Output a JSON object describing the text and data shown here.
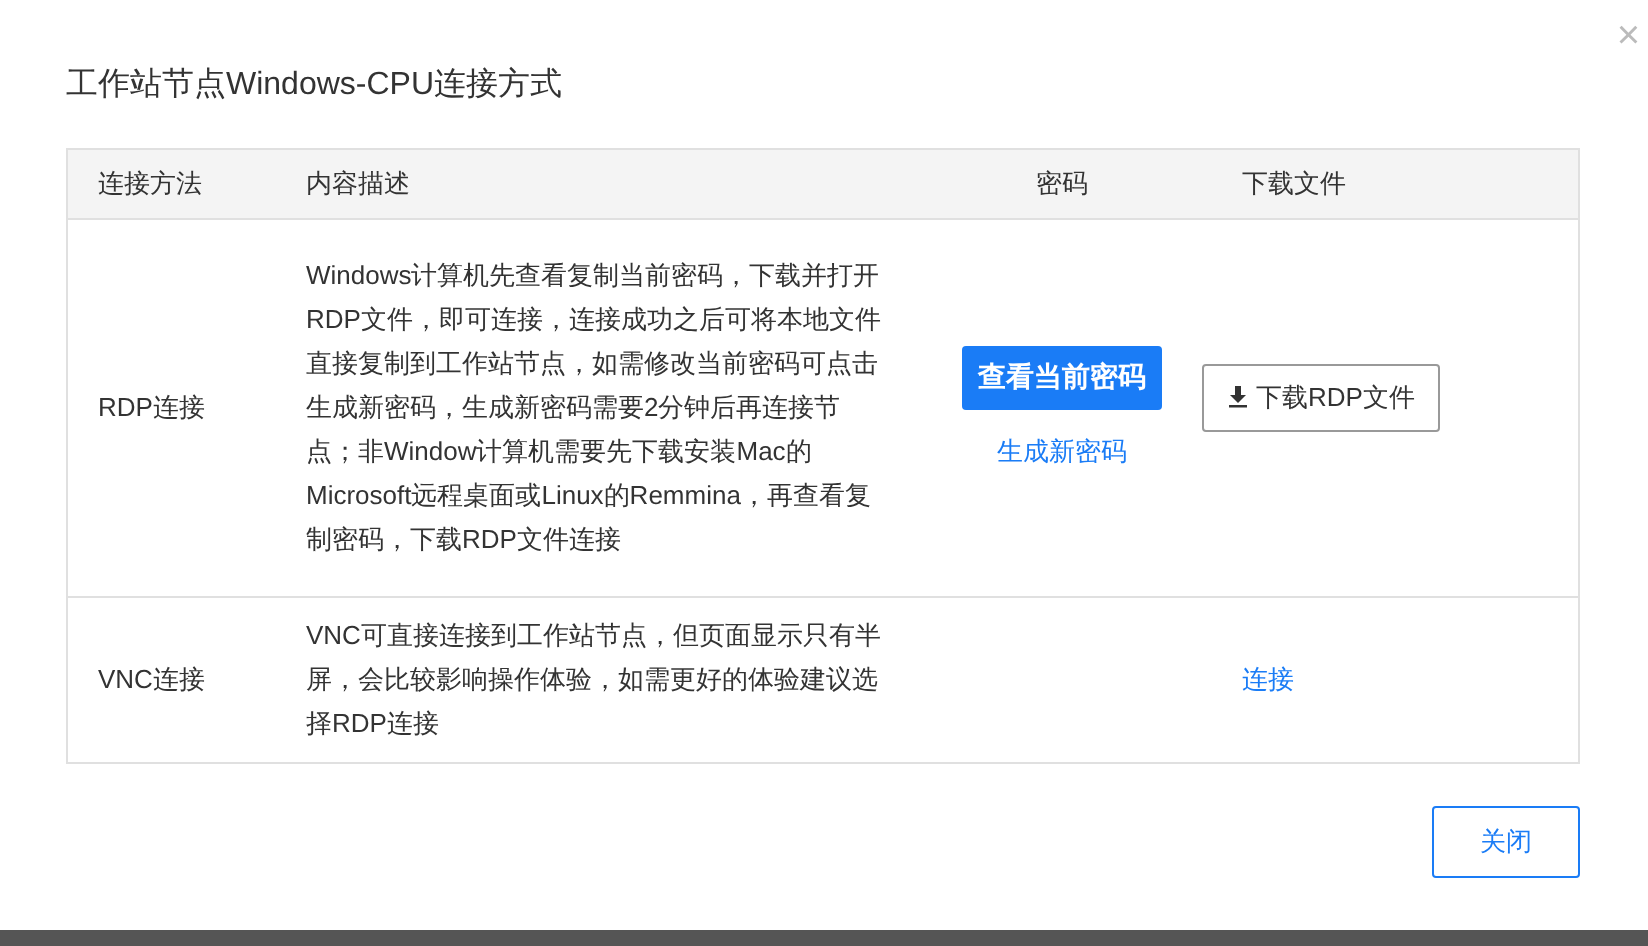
{
  "dialog": {
    "title": "工作站节点Windows-CPU连接方式",
    "close_button": "×"
  },
  "table": {
    "columns": [
      "连接方法",
      "内容描述",
      "密码",
      "下载文件"
    ],
    "rows": [
      {
        "method": "RDP连接",
        "description": "Windows计算机先查看复制当前密码，下载并打开RDP文件，即可连接，连接成功之后可将本地文件直接复制到工作站节点，如需修改当前密码可点击生成新密码，生成新密码需要2分钟后再连接节点；非Window计算机需要先下载安装Mac的Microsoft远程桌面或Linux的Remmina，再查看复制密码，下载RDP文件连接",
        "password": {
          "button": "查看当前密码",
          "link": "生成新密码"
        },
        "download": {
          "kind": "button",
          "label": "下载RDP文件"
        }
      },
      {
        "method": "VNC连接",
        "description": "VNC可直接连接到工作站节点，但页面显示只有半屏，会比较影响操作体验，如需更好的体验建议选择RDP连接",
        "download": {
          "kind": "link",
          "label": "连接"
        }
      }
    ]
  },
  "footer": {
    "button": "关闭"
  }
}
